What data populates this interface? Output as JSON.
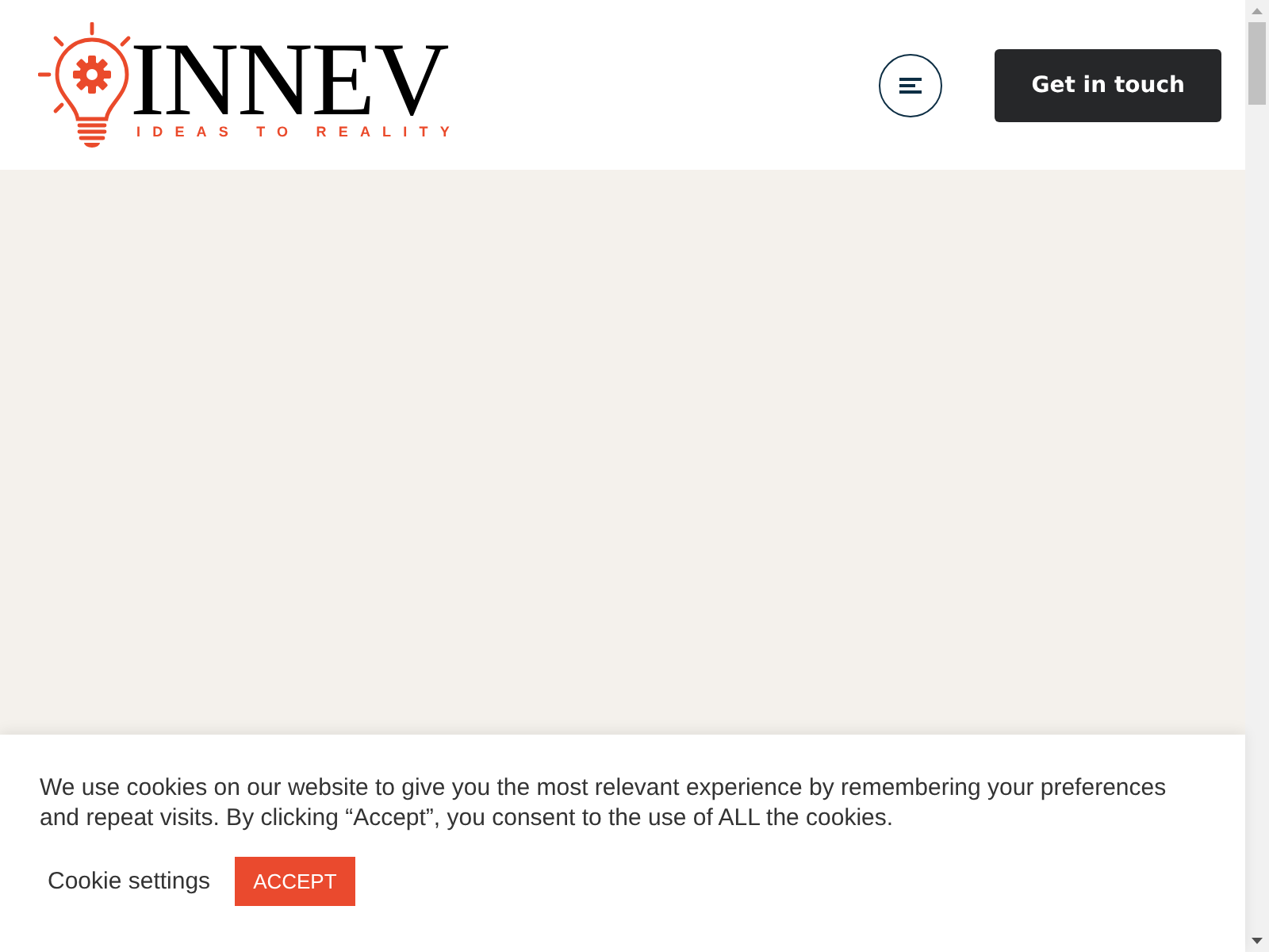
{
  "header": {
    "logo": {
      "name": "INNEV",
      "tagline": "IDEAS TO REALITY"
    },
    "cta_button": "Get in touch"
  },
  "cookie_banner": {
    "message": "We use cookies on our website to give you the most relevant experience by remembering your preferences and repeat visits. By clicking “Accept”, you consent to the use of ALL the cookies.",
    "settings_link": "Cookie settings",
    "accept_button": "ACCEPT"
  }
}
